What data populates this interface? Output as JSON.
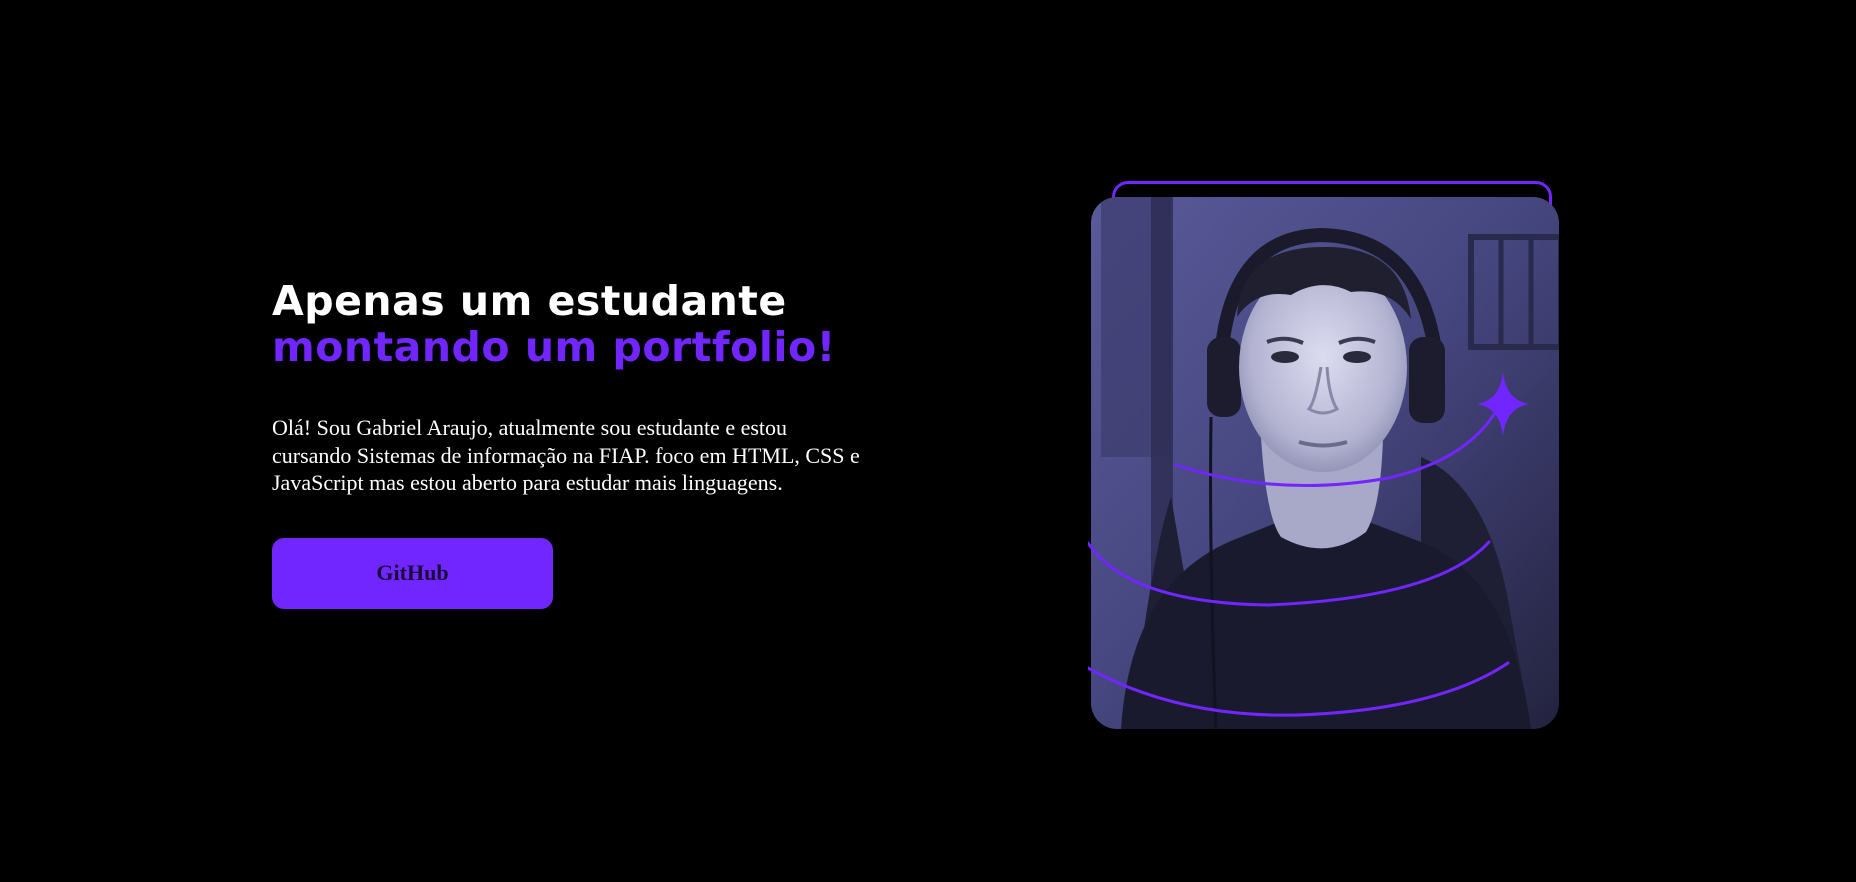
{
  "hero": {
    "headline_line1": "Apenas um estudante",
    "headline_line2": "montando um portfolio!",
    "bio": "Olá! Sou Gabriel Araujo, atualmente sou estudante e estou cursando Sistemas de informação na FIAP. foco em HTML, CSS e JavaScript mas estou aberto para estudar mais linguagens.",
    "github_label": "GitHub"
  },
  "colors": {
    "background": "#000000",
    "accent": "#7126ff",
    "text": "#ffffff",
    "photo_tint": "#4a4a86"
  },
  "icons": {
    "sparkle": "sparkle-icon",
    "orbit": "orbit-lines"
  }
}
